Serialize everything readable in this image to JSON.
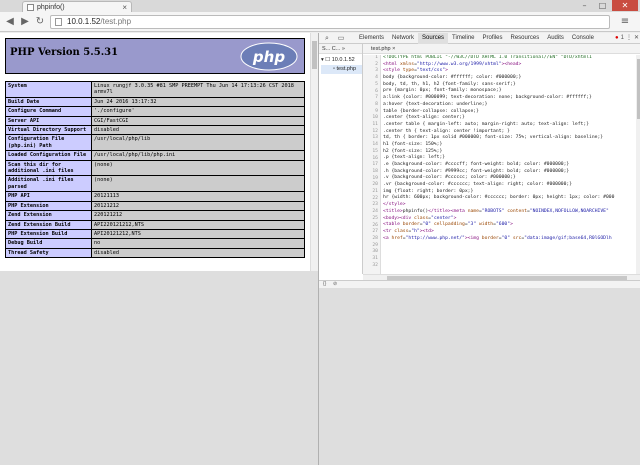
{
  "browser": {
    "tab_title": "phpinfo()",
    "tab_close": "×",
    "url_host": "10.0.1.52",
    "url_path": "/test.php",
    "back_glyph": "◀",
    "forward_glyph": "▶",
    "reload_glyph": "↻",
    "menu_glyph": "≡",
    "min_glyph": "–",
    "max_glyph": "□",
    "close_glyph": "✕"
  },
  "phpinfo": {
    "version_title": "PHP Version 5.5.31",
    "logo_text": "php",
    "rows": [
      {
        "key": "System",
        "value": "Linux rungjf 3.0.35 #81 SMP PREEMPT Thu Jun 14 17:13:26 CST 2018 armv7l"
      },
      {
        "key": "Build Date",
        "value": "Jun 24 2016 13:17:32"
      },
      {
        "key": "Configure Command",
        "value": "'./configure'"
      },
      {
        "key": "Server API",
        "value": "CGI/FastCGI"
      },
      {
        "key": "Virtual Directory Support",
        "value": "disabled"
      },
      {
        "key": "Configuration File (php.ini) Path",
        "value": "/usr/local/php/lib"
      },
      {
        "key": "Loaded Configuration File",
        "value": "/usr/local/php/lib/php.ini"
      },
      {
        "key": "Scan this dir for additional .ini files",
        "value": "(none)"
      },
      {
        "key": "Additional .ini files parsed",
        "value": "(none)"
      },
      {
        "key": "PHP API",
        "value": "20121113"
      },
      {
        "key": "PHP Extension",
        "value": "20121212"
      },
      {
        "key": "Zend Extension",
        "value": "220121212"
      },
      {
        "key": "Zend Extension Build",
        "value": "API220121212,NTS"
      },
      {
        "key": "PHP Extension Build",
        "value": "API20121212,NTS"
      },
      {
        "key": "Debug Build",
        "value": "no"
      },
      {
        "key": "Thread Safety",
        "value": "disabled"
      }
    ]
  },
  "devtools": {
    "tabs": [
      "Elements",
      "Network",
      "Sources",
      "Timeline",
      "Profiles",
      "Resources",
      "Audits",
      "Console"
    ],
    "active_tab": "Sources",
    "error_count": "1",
    "navigator_tabs": "S... C... »",
    "tree_host": "10.0.1.52",
    "tree_file": "test.php",
    "editor_tab": "test.php",
    "status_left": "{}",
    "status_right": "⊘",
    "code_lines": [
      {
        "n": "1",
        "parts": [
          [
            "c",
            "<!DOCTYPE html PUBLIC \"-//W3C//DTD XHTML 1.0 Transitional//EN\" \"DTD/xhtml1"
          ]
        ]
      },
      {
        "n": "2",
        "parts": [
          [
            "t",
            "<html "
          ],
          [
            "a",
            "xmlns"
          ],
          [
            "",
            "="
          ],
          [
            "s",
            "\"http://www.w3.org/1999/xhtml\""
          ],
          [
            "t",
            "><head>"
          ]
        ]
      },
      {
        "n": "3",
        "parts": [
          [
            "t",
            "<style "
          ],
          [
            "a",
            "type"
          ],
          [
            "",
            "="
          ],
          [
            "s",
            "\"text/css\""
          ],
          [
            "t",
            ">"
          ]
        ]
      },
      {
        "n": "4",
        "parts": [
          [
            "",
            "body {background-color: #ffffff; color: #000000;}"
          ]
        ]
      },
      {
        "n": "5",
        "parts": [
          [
            "",
            "body, td, th, h1, h2 {font-family: sans-serif;}"
          ]
        ]
      },
      {
        "n": "6",
        "parts": [
          [
            "",
            "pre {margin: 0px; font-family: monospace;}"
          ]
        ]
      },
      {
        "n": "7",
        "parts": [
          [
            "",
            "a:link {color: #000099; text-decoration: none; background-color: #ffffff;}"
          ]
        ]
      },
      {
        "n": "8",
        "parts": [
          [
            "",
            "a:hover {text-decoration: underline;}"
          ]
        ]
      },
      {
        "n": "9",
        "parts": [
          [
            "",
            "table {border-collapse: collapse;}"
          ]
        ]
      },
      {
        "n": "10",
        "parts": [
          [
            "",
            ".center {text-align: center;}"
          ]
        ]
      },
      {
        "n": "11",
        "parts": [
          [
            "",
            ".center table { margin-left: auto; margin-right: auto; text-align: left;}"
          ]
        ]
      },
      {
        "n": "12",
        "parts": [
          [
            "",
            ".center th { text-align: center !important; }"
          ]
        ]
      },
      {
        "n": "13",
        "parts": [
          [
            "",
            "td, th { border: 1px solid #000000; font-size: 75%; vertical-align: baseline;}"
          ]
        ]
      },
      {
        "n": "14",
        "parts": [
          [
            "",
            "h1 {font-size: 150%;}"
          ]
        ]
      },
      {
        "n": "15",
        "parts": [
          [
            "",
            "h2 {font-size: 125%;}"
          ]
        ]
      },
      {
        "n": "16",
        "parts": [
          [
            "",
            ".p {text-align: left;}"
          ]
        ]
      },
      {
        "n": "17",
        "parts": [
          [
            "",
            ".e {background-color: #ccccff; font-weight: bold; color: #000000;}"
          ]
        ]
      },
      {
        "n": "18",
        "parts": [
          [
            "",
            ".h {background-color: #9999cc; font-weight: bold; color: #000000;}"
          ]
        ]
      },
      {
        "n": "19",
        "parts": [
          [
            "",
            ".v {background-color: #cccccc; color: #000000;}"
          ]
        ]
      },
      {
        "n": "20",
        "parts": [
          [
            "",
            ".vr {background-color: #cccccc; text-align: right; color: #000000;}"
          ]
        ]
      },
      {
        "n": "21",
        "parts": [
          [
            "",
            "img {float: right; border: 0px;}"
          ]
        ]
      },
      {
        "n": "22",
        "parts": [
          [
            "",
            "hr {width: 600px; background-color: #cccccc; border: 0px; height: 1px; color: #000"
          ]
        ]
      },
      {
        "n": "23",
        "parts": [
          [
            "t",
            "</style>"
          ]
        ]
      },
      {
        "n": "24",
        "parts": [
          [
            "t",
            "<title>"
          ],
          [
            "",
            "phpinfo()"
          ],
          [
            "t",
            "</title><meta "
          ],
          [
            "a",
            "name"
          ],
          [
            "",
            "="
          ],
          [
            "s",
            "\"ROBOTS\""
          ],
          [
            "a",
            " content"
          ],
          [
            "",
            "="
          ],
          [
            "s",
            "\"NOINDEX,NOFOLLOW,NOARCHIVE\""
          ]
        ]
      },
      {
        "n": "25",
        "parts": [
          [
            "t",
            "<body><div "
          ],
          [
            "a",
            "class"
          ],
          [
            "",
            "="
          ],
          [
            "s",
            "\"center\""
          ],
          [
            "t",
            ">"
          ]
        ]
      },
      {
        "n": "26",
        "parts": [
          [
            "t",
            "<table "
          ],
          [
            "a",
            "border"
          ],
          [
            "",
            "="
          ],
          [
            "s",
            "\"0\""
          ],
          [
            "a",
            " cellpadding"
          ],
          [
            "",
            "="
          ],
          [
            "s",
            "\"3\""
          ],
          [
            "a",
            " width"
          ],
          [
            "",
            "="
          ],
          [
            "s",
            "\"600\""
          ],
          [
            "t",
            ">"
          ]
        ]
      },
      {
        "n": "27",
        "parts": [
          [
            "t",
            "<tr "
          ],
          [
            "a",
            "class"
          ],
          [
            "",
            "="
          ],
          [
            "s",
            "\"h\""
          ],
          [
            "t",
            "><td>"
          ]
        ]
      },
      {
        "n": "28",
        "parts": [
          [
            "t",
            "<a "
          ],
          [
            "a",
            "href"
          ],
          [
            "",
            "="
          ],
          [
            "s",
            "\"http://www.php.net/\""
          ],
          [
            "t",
            "><img "
          ],
          [
            "a",
            "border"
          ],
          [
            "",
            "="
          ],
          [
            "s",
            "\"0\""
          ],
          [
            "a",
            " src"
          ],
          [
            "",
            "="
          ],
          [
            "s",
            "\"data:image/gif;base64,R0lGODlh"
          ]
        ]
      },
      {
        "n": "29",
        "parts": [
          [
            "",
            ""
          ]
        ]
      },
      {
        "n": "30",
        "parts": [
          [
            "",
            ""
          ]
        ]
      },
      {
        "n": "31",
        "parts": [
          [
            "",
            ""
          ]
        ]
      },
      {
        "n": "32",
        "parts": [
          [
            "",
            ""
          ]
        ]
      }
    ]
  }
}
